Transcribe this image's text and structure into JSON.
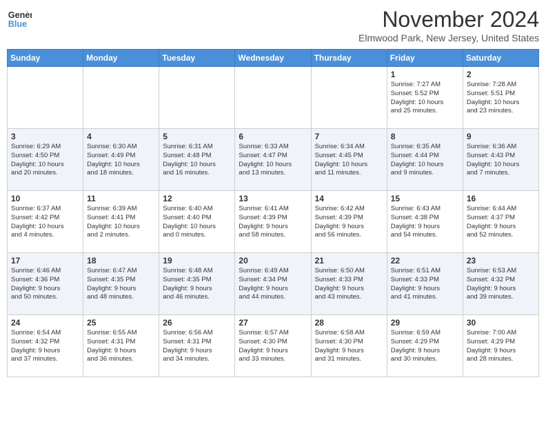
{
  "header": {
    "logo_line1": "General",
    "logo_line2": "Blue",
    "title": "November 2024",
    "subtitle": "Elmwood Park, New Jersey, United States"
  },
  "weekdays": [
    "Sunday",
    "Monday",
    "Tuesday",
    "Wednesday",
    "Thursday",
    "Friday",
    "Saturday"
  ],
  "weeks": [
    [
      {
        "day": "",
        "info": ""
      },
      {
        "day": "",
        "info": ""
      },
      {
        "day": "",
        "info": ""
      },
      {
        "day": "",
        "info": ""
      },
      {
        "day": "",
        "info": ""
      },
      {
        "day": "1",
        "info": "Sunrise: 7:27 AM\nSunset: 5:52 PM\nDaylight: 10 hours\nand 25 minutes."
      },
      {
        "day": "2",
        "info": "Sunrise: 7:28 AM\nSunset: 5:51 PM\nDaylight: 10 hours\nand 23 minutes."
      }
    ],
    [
      {
        "day": "3",
        "info": "Sunrise: 6:29 AM\nSunset: 4:50 PM\nDaylight: 10 hours\nand 20 minutes."
      },
      {
        "day": "4",
        "info": "Sunrise: 6:30 AM\nSunset: 4:49 PM\nDaylight: 10 hours\nand 18 minutes."
      },
      {
        "day": "5",
        "info": "Sunrise: 6:31 AM\nSunset: 4:48 PM\nDaylight: 10 hours\nand 16 minutes."
      },
      {
        "day": "6",
        "info": "Sunrise: 6:33 AM\nSunset: 4:47 PM\nDaylight: 10 hours\nand 13 minutes."
      },
      {
        "day": "7",
        "info": "Sunrise: 6:34 AM\nSunset: 4:45 PM\nDaylight: 10 hours\nand 11 minutes."
      },
      {
        "day": "8",
        "info": "Sunrise: 6:35 AM\nSunset: 4:44 PM\nDaylight: 10 hours\nand 9 minutes."
      },
      {
        "day": "9",
        "info": "Sunrise: 6:36 AM\nSunset: 4:43 PM\nDaylight: 10 hours\nand 7 minutes."
      }
    ],
    [
      {
        "day": "10",
        "info": "Sunrise: 6:37 AM\nSunset: 4:42 PM\nDaylight: 10 hours\nand 4 minutes."
      },
      {
        "day": "11",
        "info": "Sunrise: 6:39 AM\nSunset: 4:41 PM\nDaylight: 10 hours\nand 2 minutes."
      },
      {
        "day": "12",
        "info": "Sunrise: 6:40 AM\nSunset: 4:40 PM\nDaylight: 10 hours\nand 0 minutes."
      },
      {
        "day": "13",
        "info": "Sunrise: 6:41 AM\nSunset: 4:39 PM\nDaylight: 9 hours\nand 58 minutes."
      },
      {
        "day": "14",
        "info": "Sunrise: 6:42 AM\nSunset: 4:39 PM\nDaylight: 9 hours\nand 56 minutes."
      },
      {
        "day": "15",
        "info": "Sunrise: 6:43 AM\nSunset: 4:38 PM\nDaylight: 9 hours\nand 54 minutes."
      },
      {
        "day": "16",
        "info": "Sunrise: 6:44 AM\nSunset: 4:37 PM\nDaylight: 9 hours\nand 52 minutes."
      }
    ],
    [
      {
        "day": "17",
        "info": "Sunrise: 6:46 AM\nSunset: 4:36 PM\nDaylight: 9 hours\nand 50 minutes."
      },
      {
        "day": "18",
        "info": "Sunrise: 6:47 AM\nSunset: 4:35 PM\nDaylight: 9 hours\nand 48 minutes."
      },
      {
        "day": "19",
        "info": "Sunrise: 6:48 AM\nSunset: 4:35 PM\nDaylight: 9 hours\nand 46 minutes."
      },
      {
        "day": "20",
        "info": "Sunrise: 6:49 AM\nSunset: 4:34 PM\nDaylight: 9 hours\nand 44 minutes."
      },
      {
        "day": "21",
        "info": "Sunrise: 6:50 AM\nSunset: 4:33 PM\nDaylight: 9 hours\nand 43 minutes."
      },
      {
        "day": "22",
        "info": "Sunrise: 6:51 AM\nSunset: 4:33 PM\nDaylight: 9 hours\nand 41 minutes."
      },
      {
        "day": "23",
        "info": "Sunrise: 6:53 AM\nSunset: 4:32 PM\nDaylight: 9 hours\nand 39 minutes."
      }
    ],
    [
      {
        "day": "24",
        "info": "Sunrise: 6:54 AM\nSunset: 4:32 PM\nDaylight: 9 hours\nand 37 minutes."
      },
      {
        "day": "25",
        "info": "Sunrise: 6:55 AM\nSunset: 4:31 PM\nDaylight: 9 hours\nand 36 minutes."
      },
      {
        "day": "26",
        "info": "Sunrise: 6:56 AM\nSunset: 4:31 PM\nDaylight: 9 hours\nand 34 minutes."
      },
      {
        "day": "27",
        "info": "Sunrise: 6:57 AM\nSunset: 4:30 PM\nDaylight: 9 hours\nand 33 minutes."
      },
      {
        "day": "28",
        "info": "Sunrise: 6:58 AM\nSunset: 4:30 PM\nDaylight: 9 hours\nand 31 minutes."
      },
      {
        "day": "29",
        "info": "Sunrise: 6:59 AM\nSunset: 4:29 PM\nDaylight: 9 hours\nand 30 minutes."
      },
      {
        "day": "30",
        "info": "Sunrise: 7:00 AM\nSunset: 4:29 PM\nDaylight: 9 hours\nand 28 minutes."
      }
    ]
  ]
}
